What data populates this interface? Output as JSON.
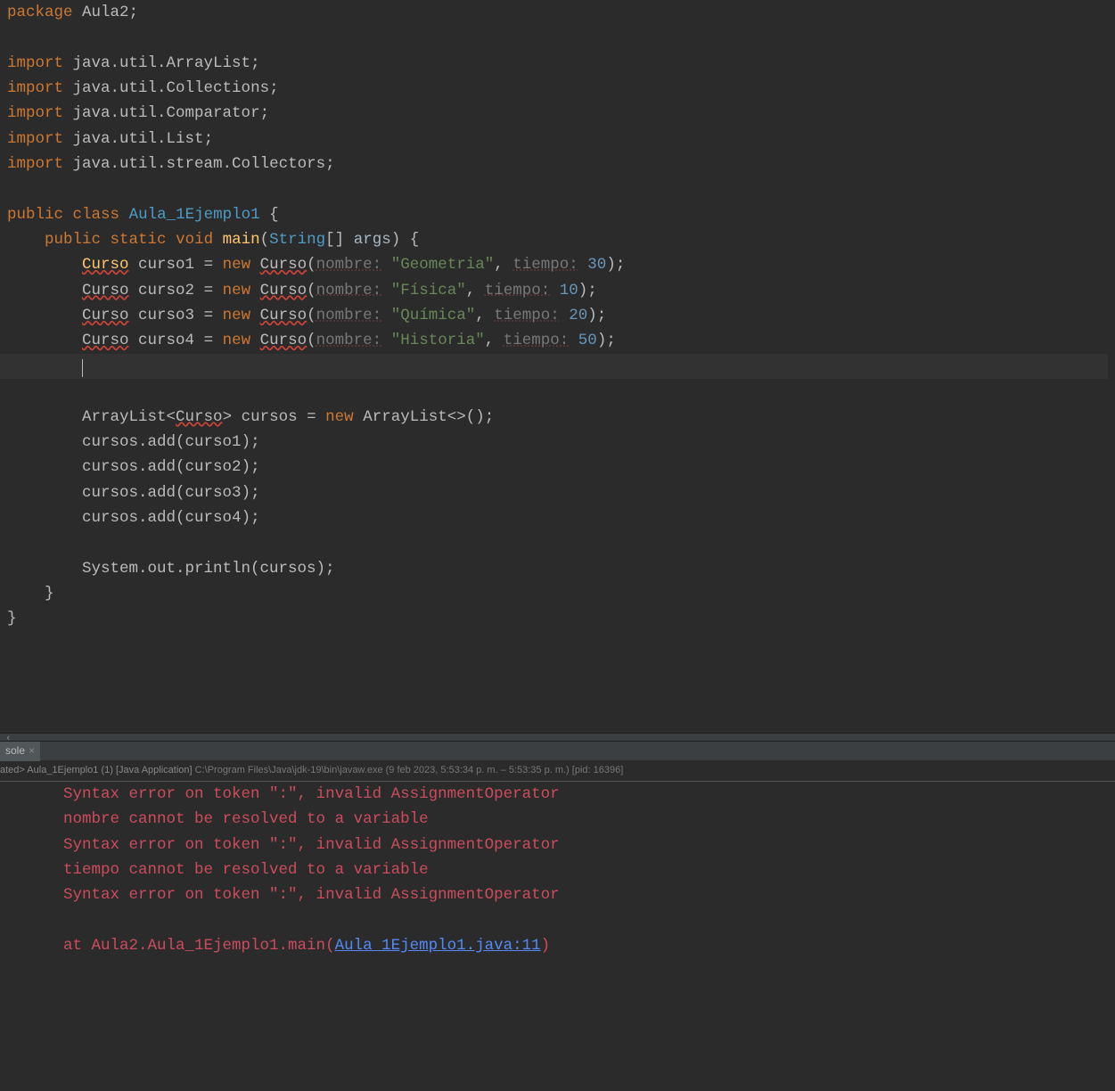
{
  "code": {
    "pkg_kw": "package",
    "pkg_name": "Aula2",
    "semi": ";",
    "import_kw": "import",
    "imp1": "java.util.ArrayList",
    "imp2": "java.util.Collections",
    "imp3": "java.util.Comparator",
    "imp4": "java.util.List",
    "imp5": "java.util.stream.Collectors",
    "public_kw": "public",
    "class_kw": "class",
    "classn": "Aula_1Ejemplo1",
    "brace_o": "{",
    "brace_c": "}",
    "static_kw": "static",
    "void_kw": "void",
    "main": "main",
    "lparen": "(",
    "rparen": ")",
    "String": "String",
    "brackets": "[]",
    "args": "args",
    "Curso": "Curso",
    "c1": "curso1",
    "c2": "curso2",
    "c3": "curso3",
    "c4": "curso4",
    "eq": "=",
    "new_kw": "new",
    "nombre_h": "nombre:",
    "tiempo_h": "tiempo:",
    "s1": "\"Geometria\"",
    "s2": "\"Física\"",
    "s3": "\"Química\"",
    "s4": "\"Historia\"",
    "n1": "30",
    "n2": "10",
    "n3": "20",
    "n4": "50",
    "comma": ",",
    "ArrayList": "ArrayList",
    "lt": "<",
    "gt": ">",
    "cursos": "cursos",
    "diamond": "<>",
    "parens": "()",
    "add": ".add(",
    "rp_semi": ");",
    "sysout": "System.out.println(cursos);"
  },
  "tab": {
    "label": "sole",
    "close": "×"
  },
  "header": {
    "status": "ated>",
    "app": "Aula_1Ejemplo1 (1) [Java Application]",
    "path": "C:\\Program Files\\Java\\jdk-19\\bin\\javaw.exe",
    "ts": "(9 feb 2023, 5:53:34 p. m. – 5:53:35 p. m.) [pid: 16396]"
  },
  "console": {
    "l1": "Syntax error on token \":\", invalid AssignmentOperator",
    "l2": "nombre cannot be resolved to a variable",
    "l3": "Syntax error on token \":\", invalid AssignmentOperator",
    "l4": "tiempo cannot be resolved to a variable",
    "l5": "Syntax error on token \":\", invalid AssignmentOperator",
    "at": "at Aula2.Aula_1Ejemplo1.main(",
    "link": "Aula_1Ejemplo1.java:11",
    "rp": ")"
  }
}
